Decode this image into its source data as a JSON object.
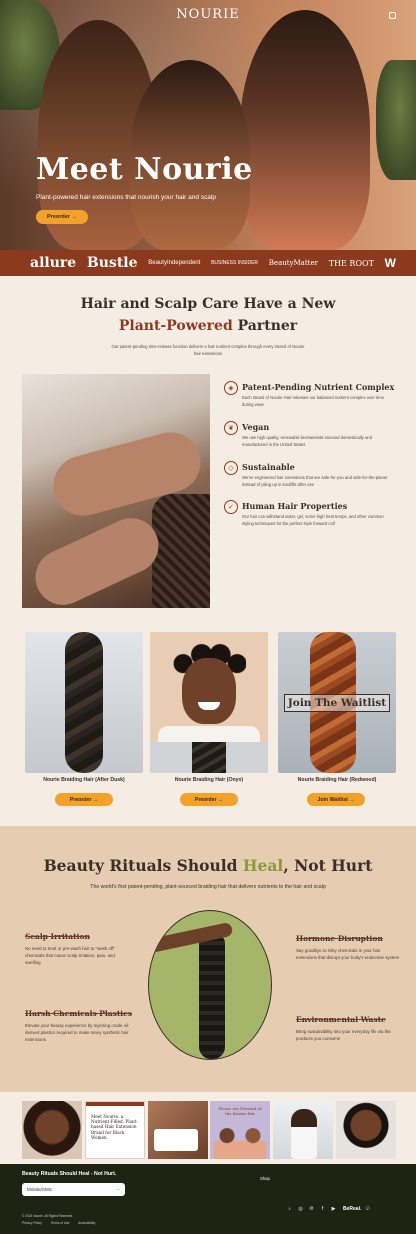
{
  "hero": {
    "logo": "NOURIE",
    "title": "Meet Nourie",
    "subtitle": "Plant-powered hair extensions that nourish your hair and scalp",
    "cta": "Preorder →"
  },
  "press": [
    "allure",
    "Bustle",
    "BeautyIndependent",
    "BUSINESS INSIDER",
    "BeautyMatter",
    "THE ROOT",
    "W"
  ],
  "intro": {
    "title_line1": "Hair and Scalp Care Have a New",
    "title_accent": "Plant-Powered",
    "title_end": "Partner",
    "body": "Our patent-pending time-release function delivers a hair nutrient complex through every strand of Nourie hair extensions"
  },
  "features": [
    {
      "icon": "dna-icon",
      "title": "Patent-Pending Nutrient Complex",
      "body": "Each strand of Nourie Hair releases our balanced nutrient complex over time during wear"
    },
    {
      "icon": "leaf-icon",
      "title": "Vegan",
      "body": "We use high quality, renewable biomaterials sourced domestically and manufactured in the United States"
    },
    {
      "icon": "diamond-icon",
      "title": "Sustainable",
      "body": "We've engineered hair extensions that are safe-for-you and safe-for-the-planet instead of piling up in landfills after use"
    },
    {
      "icon": "check-icon",
      "title": "Human Hair Properties",
      "body": "Our hair can withstand water, gel, some high heat temps, and other common styling techniques for the perfect style forward coif"
    }
  ],
  "products": [
    {
      "name": "Nourie Braiding Hair (After Dusk)",
      "cta": "Preorder →"
    },
    {
      "name": "Nourie Braiding Hair (Onyx)",
      "cta": "Preorder →"
    },
    {
      "name": "Nourie Braiding Hair (Redwood)",
      "cta": "Join Waitlist →",
      "overlay": "Join The Waitlist"
    }
  ],
  "rituals": {
    "title_start": "Beauty Rituals Should",
    "title_accent": "Heal",
    "title_end": ", Not Hurt",
    "subtitle": "The world's first patent-pending, plant-sourced braiding hair that delivers nutrients to the hair and scalp",
    "items": [
      {
        "title": "Scalp Irritation",
        "body": "No need to treat or pre-wash hair to \"wash off\" chemicals that cause scalp irritation, pain, and swelling"
      },
      {
        "title": "Hormone Disruption",
        "body": "Say goodbye to risky chemicals in your hair extensions that disrupt your body's endocrine system"
      },
      {
        "title": "Harsh Chemicals Plastics",
        "body": "Elevate your beauty experience by rejecting crude oil-derived plastics required to make many synthetic hair extensions"
      },
      {
        "title": "Environmental Waste",
        "body": "Bring sustainability into your everyday life via the products you consume"
      }
    ]
  },
  "gallery": {
    "article_title": "Meet Nourie, a Nutrient-Filled, Plant-based Hair Extension Brand for Black Women",
    "poster_text": "Please use Forward of the Kisstur Hut"
  },
  "footer": {
    "title": "Beauty Rituals Should Heal - Not Hurt.",
    "input_value": "Mobile/SMS",
    "shop": "Shop",
    "copyright": "© 2024 Nourie. All Rights Reserved.",
    "links": [
      "Privacy Policy",
      "Terms of Use",
      "Accessibility"
    ],
    "brand": "BeReal."
  },
  "colors": {
    "accent": "#8b3a1e",
    "cta": "#f2a12a",
    "sage": "#8a9a3a",
    "footer_bg": "#1e2312"
  }
}
